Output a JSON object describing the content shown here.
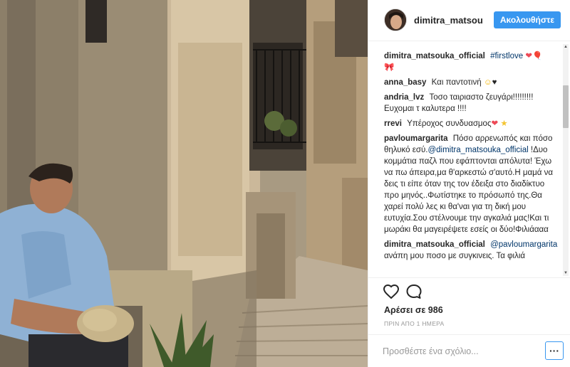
{
  "post": {
    "photo_alt": "Man sitting on stone steps in a narrow sunlit alley",
    "author": "dimitra_matsouka",
    "follow_label": "Ακολουθήστε"
  },
  "comments": [
    {
      "user": "dimitra_matsouka_official",
      "text": "#firstlove",
      "emoji": "❤🎈",
      "extra": "🎀"
    },
    {
      "user": "anna_basy",
      "text": "Και παντοτινή",
      "emoji_a": "☺",
      "emoji_b": "♥"
    },
    {
      "user": "andria_lvz",
      "text": "Τοσο ταιριαστο ζευγάρι!!!!!!!!! Ευχομαι τ καλυτερα !!!!"
    },
    {
      "user": "rrevi",
      "text": "Υπέροχος συνδυασμος",
      "emoji_a": "❤",
      "emoji_b": "★"
    },
    {
      "user": "pavloumargarita",
      "text_a": "Πόσο αρρενωπός και πόσο θηλυκό εσύ.",
      "mention": "@dimitra_matsouka_official",
      "text_b": " !Δυο κομμάτια παζλ που εφάπτονται απόλυτα! Έχω να πω άπειρα,μα θ'αρκεστώ σ'αυτό.Η μαμά να δεις τι είπε όταν της τον έδειξα στο διαδίκτυο προ μηνός..Φωτίστηκε το πρόσωπό της.Θα χαρεί πολύ λες κι θα'ναι για τη δική μου ευτυχία.Σου στέλνουμε την αγκαλιά μας!Και τι μωράκι θα μαγειρέψετε εσείς οι δύο!Φιλιάααα"
    },
    {
      "user": "dimitra_matsouka_official",
      "mention": "@pavloumargarita",
      "text": " ανάπη μου ποσο με συγκινεις. Τα φιλιά"
    }
  ],
  "likes_label": "Αρέσει σε 986",
  "timestamp": "ΠΡΙΝ ΑΠΟ 1 ΗΜΕΡΑ",
  "comment_placeholder": "Προσθέστε ένα σχόλιο...",
  "more_label": "···",
  "icons": {
    "like": "heart-icon",
    "comment": "comment-icon",
    "more": "more-options-icon"
  },
  "colors": {
    "accent": "#3897f0",
    "link": "#003569",
    "muted": "#999999"
  }
}
